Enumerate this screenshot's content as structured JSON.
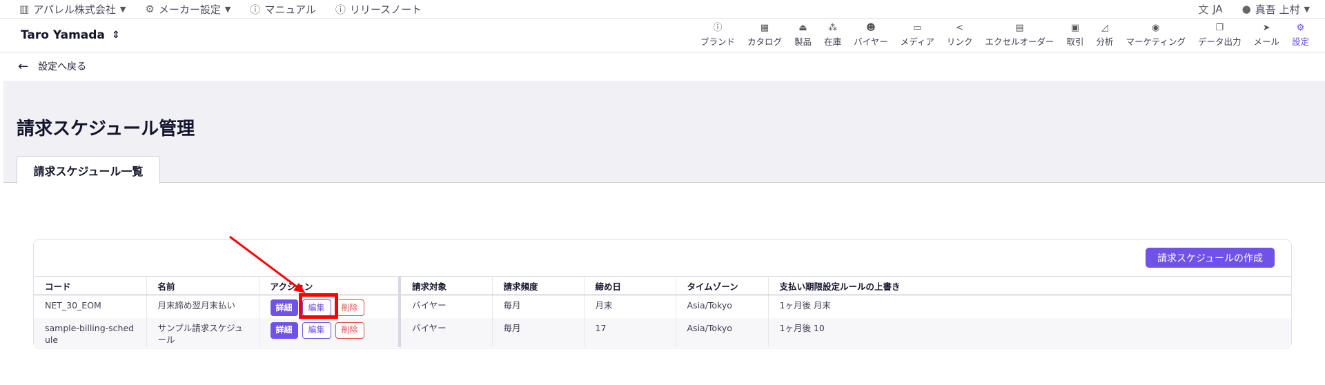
{
  "topbar": {
    "company": "アパレル株式会社",
    "maker_settings": "メーカー設定",
    "manual": "マニュアル",
    "release_notes": "リリースノート",
    "language": "JA",
    "user": "真吾 上村"
  },
  "header": {
    "current_user": "Taro Yamada",
    "nav": [
      {
        "label": "ブランド",
        "icon": "info-icon"
      },
      {
        "label": "カタログ",
        "icon": "catalog-icon"
      },
      {
        "label": "製品",
        "icon": "hanger-icon"
      },
      {
        "label": "在庫",
        "icon": "boxes-icon"
      },
      {
        "label": "バイヤー",
        "icon": "people-icon"
      },
      {
        "label": "メディア",
        "icon": "cast-icon"
      },
      {
        "label": "リンク",
        "icon": "share-icon"
      },
      {
        "label": "エクセルオーダー",
        "icon": "excel-icon"
      },
      {
        "label": "取引",
        "icon": "message-icon"
      },
      {
        "label": "分析",
        "icon": "chart-icon"
      },
      {
        "label": "マーケティング",
        "icon": "broadcast-icon"
      },
      {
        "label": "データ出力",
        "icon": "copy-icon"
      },
      {
        "label": "メール",
        "icon": "send-icon"
      },
      {
        "label": "設定",
        "icon": "gear-icon"
      }
    ]
  },
  "back": {
    "label": "設定へ戻る"
  },
  "page": {
    "title": "請求スケジュール管理",
    "tab": "請求スケジュール一覧",
    "create_button": "請求スケジュールの作成"
  },
  "table": {
    "headers": [
      "コード",
      "名前",
      "アクション",
      "請求対象",
      "請求頻度",
      "締め日",
      "タイムゾーン",
      "支払い期限設定ルールの上書き"
    ],
    "actions": {
      "detail": "詳細",
      "edit": "編集",
      "delete": "削除"
    },
    "rows": [
      {
        "code": "NET_30_EOM",
        "name": "月末締め翌月末払い",
        "target": "バイヤー",
        "frequency": "毎月",
        "closing": "月末",
        "timezone": "Asia/Tokyo",
        "override": "1ヶ月後 月末"
      },
      {
        "code": "sample-billing-schedule",
        "name": "サンプル請求スケジュール",
        "target": "バイヤー",
        "frequency": "毎月",
        "closing": "17",
        "timezone": "Asia/Tokyo",
        "override": "1ヶ月後 10"
      }
    ]
  },
  "colors": {
    "accent": "#7052e8",
    "danger": "#e24a4a",
    "annotation": "#ff0000"
  }
}
